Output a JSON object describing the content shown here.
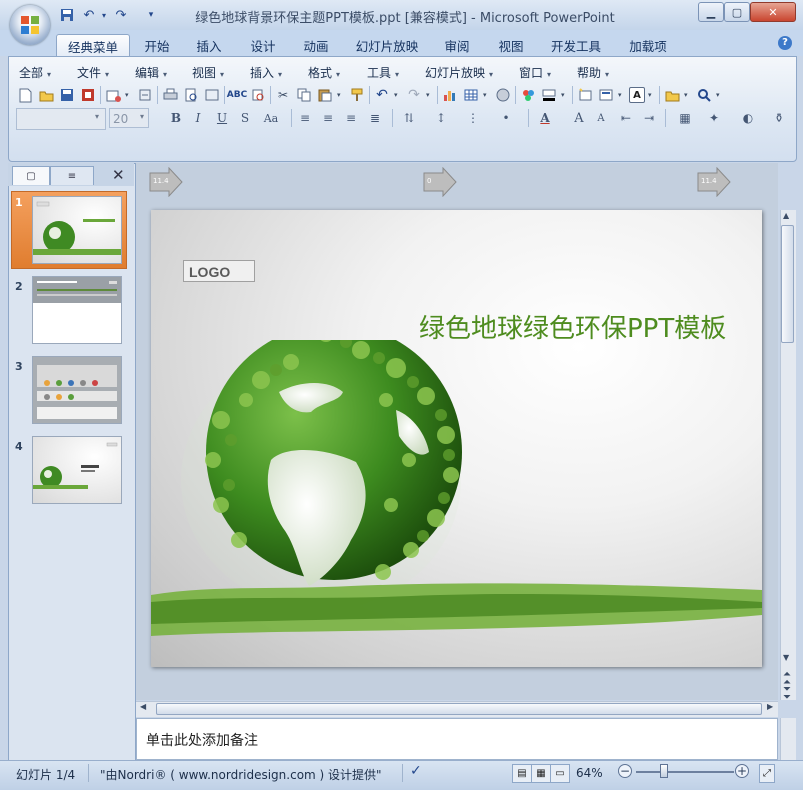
{
  "window": {
    "title": "绿色地球背景环保主题PPT模板.ppt [兼容模式] - Microsoft PowerPoint"
  },
  "ribbon_tabs": [
    "经典菜单",
    "开始",
    "插入",
    "设计",
    "动画",
    "幻灯片放映",
    "审阅",
    "视图",
    "开发工具",
    "加载项"
  ],
  "menu": [
    "全部",
    "文件",
    "编辑",
    "视图",
    "插入",
    "格式",
    "工具",
    "幻灯片放映",
    "窗口",
    "帮助"
  ],
  "format_toolbar": {
    "font_name": "",
    "font_size": "20"
  },
  "slides_pane": {
    "thumbnail_numbers": [
      "1",
      "2",
      "3",
      "4"
    ],
    "selected_slide": "1"
  },
  "slide": {
    "logo_text": "LOGO",
    "title": "绿色地球绿色环保PPT模板"
  },
  "slide_nav_arrows": [
    "11.4",
    "0",
    "11.4"
  ],
  "notes": {
    "placeholder": "单击此处添加备注"
  },
  "status": {
    "slide_counter": "幻灯片 1/4",
    "theme": "\"由Nordri® ( www.nordridesign.com ) 设计提供\"",
    "zoom": "64%"
  },
  "colors": {
    "title_green": "#4e8c1f",
    "selected_thumb": "#e9893d",
    "ribbon_blue": "#c5d7ee"
  }
}
